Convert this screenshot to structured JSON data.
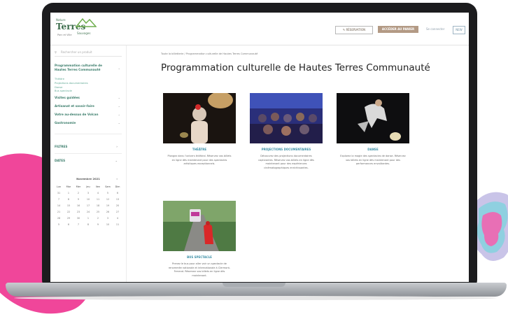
{
  "logo": {
    "pre": "Nature",
    "main": "Terres",
    "accent": "Sauvages",
    "sub": "Parc et Ville"
  },
  "header": {
    "search_btn": "RÉSERVATION",
    "account_btn": "ACCÉDER AU PANIER",
    "login_link": "Se connecter",
    "lang_btn": "NEW"
  },
  "sidebar": {
    "search_placeholder": "Rechercher un produit",
    "menu_main": "Programmation culturelle de Hautes Terres Communauté",
    "subitems": [
      "Théâtre",
      "Projections documentaires",
      "Danse",
      "Bus spectacle"
    ],
    "menu_items": [
      "Visites guidées",
      "Artisanat et savoir-faire",
      "Votre au-dessus de Volcan",
      "Gastronomie"
    ],
    "filters_label": "FILTRES",
    "dates_label": "DATES",
    "calendar": {
      "month": "Novembre 2021",
      "days": [
        "Lun",
        "Mar",
        "Mer",
        "Jeu",
        "Ven",
        "Sam",
        "Dim"
      ],
      "weeks": [
        [
          "31",
          "1",
          "2",
          "3",
          "4",
          "5",
          "6"
        ],
        [
          "7",
          "8",
          "9",
          "10",
          "11",
          "12",
          "13"
        ],
        [
          "14",
          "15",
          "16",
          "17",
          "18",
          "19",
          "20"
        ],
        [
          "21",
          "22",
          "23",
          "24",
          "25",
          "26",
          "27"
        ],
        [
          "28",
          "29",
          "30",
          "1",
          "2",
          "3",
          "4"
        ],
        [
          "5",
          "6",
          "7",
          "8",
          "9",
          "10",
          "11"
        ]
      ]
    }
  },
  "main": {
    "breadcrumb": "Toute la billetterie  /  Programmation culturelle de Hautes Terres Communauté",
    "title": "Programmation culturelle de Hautes Terres Communauté",
    "cards": [
      {
        "title": "THÉÂTRE",
        "desc": "Plongez dans l'univers théâtral. Réservez vos billets en ligne dès maintenant pour des spectacles artistiques exceptionnels."
      },
      {
        "title": "PROJECTIONS DOCUMENTAIRES",
        "desc": "Découvrez des projections documentaires captivantes. Réservez vos billets en ligne dès maintenant pour des expériences cinématographiques enrichissantes."
      },
      {
        "title": "DANSE",
        "desc": "Explorez la magie des spectacles de danse. Réservez vos billets en ligne dès maintenant pour des performances envoûtantes."
      },
      {
        "title": "BUS SPECTACLE",
        "desc": "Prenez le bus pour aller voir un spectacle de renommée nationale et internationale à Clermont-Ferrand. Réservez vos billets en ligne dès maintenant."
      }
    ]
  },
  "colors": {
    "pink": "#f0469a",
    "teal": "#3b8ea5",
    "green": "#3b7d6b",
    "accent": "#b39a85"
  }
}
